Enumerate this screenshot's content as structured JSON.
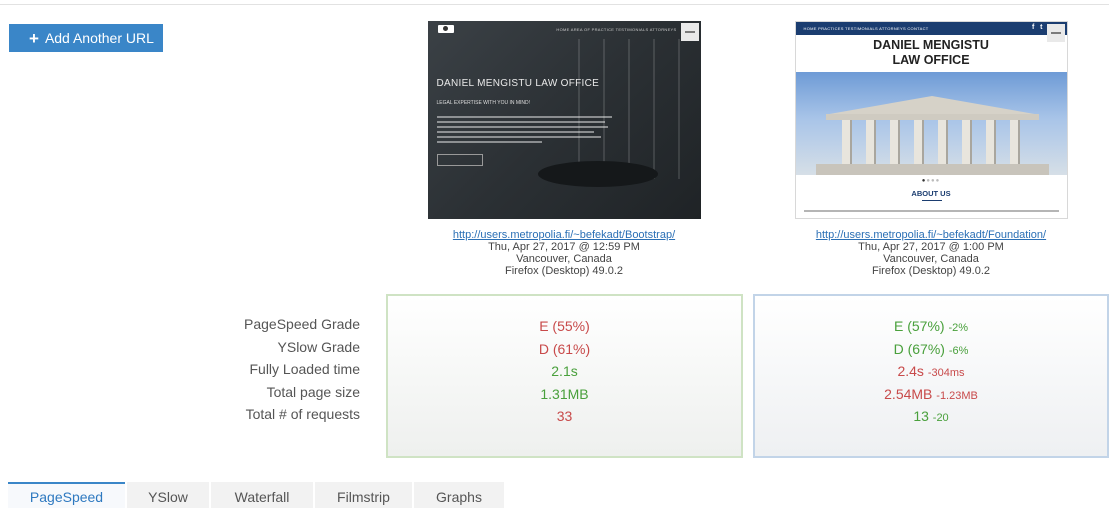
{
  "toolbar": {
    "add_url_label": "Add Another URL"
  },
  "sites": [
    {
      "url": "http://users.metropolia.fi/~befekadt/Bootstrap/",
      "date": "Thu, Apr 27, 2017 @ 12:59 PM",
      "location": "Vancouver, Canada",
      "browser": "Firefox (Desktop) 49.0.2",
      "thumb": {
        "nav": "HOME   AREA OF PRACTICE   TESTIMONIALS   ATTORNEYS",
        "headline": "DANIEL MENGISTU LAW OFFICE",
        "subhead": "LEGAL EXPERTISE WITH YOU IN MIND!"
      }
    },
    {
      "url": "http://users.metropolia.fi/~befekadt/Foundation/",
      "date": "Thu, Apr 27, 2017 @ 1:00 PM",
      "location": "Vancouver, Canada",
      "browser": "Firefox (Desktop) 49.0.2",
      "thumb": {
        "nav": "HOME   PRACTICES   TESTIMONIALS   ATTORNEYS   CONTACT",
        "title_line1": "DANIEL MENGISTU",
        "title_line2": "LAW OFFICE",
        "section": "ABOUT US"
      }
    }
  ],
  "metric_labels": [
    "PageSpeed Grade",
    "YSlow Grade",
    "Fully Loaded time",
    "Total page size",
    "Total # of requests"
  ],
  "metrics": [
    [
      {
        "value": "E (55%)",
        "delta": "",
        "status": "bad"
      },
      {
        "value": "D (61%)",
        "delta": "",
        "status": "bad"
      },
      {
        "value": "2.1s",
        "delta": "",
        "status": "good"
      },
      {
        "value": "1.31MB",
        "delta": "",
        "status": "good"
      },
      {
        "value": "33",
        "delta": "",
        "status": "bad"
      }
    ],
    [
      {
        "value": "E (57%)",
        "delta": "-2%",
        "status": "good"
      },
      {
        "value": "D (67%)",
        "delta": "-6%",
        "status": "good"
      },
      {
        "value": "2.4s",
        "delta": "-304ms",
        "status": "bad"
      },
      {
        "value": "2.54MB",
        "delta": "-1.23MB",
        "status": "bad"
      },
      {
        "value": "13",
        "delta": "-20",
        "status": "good"
      }
    ]
  ],
  "tabs": [
    {
      "label": "PageSpeed",
      "active": true
    },
    {
      "label": "YSlow",
      "active": false
    },
    {
      "label": "Waterfall",
      "active": false
    },
    {
      "label": "Filmstrip",
      "active": false
    },
    {
      "label": "Graphs",
      "active": false
    }
  ],
  "colors": {
    "accent": "#3a86c8",
    "good": "#49a03c",
    "bad": "#c84a4a"
  }
}
